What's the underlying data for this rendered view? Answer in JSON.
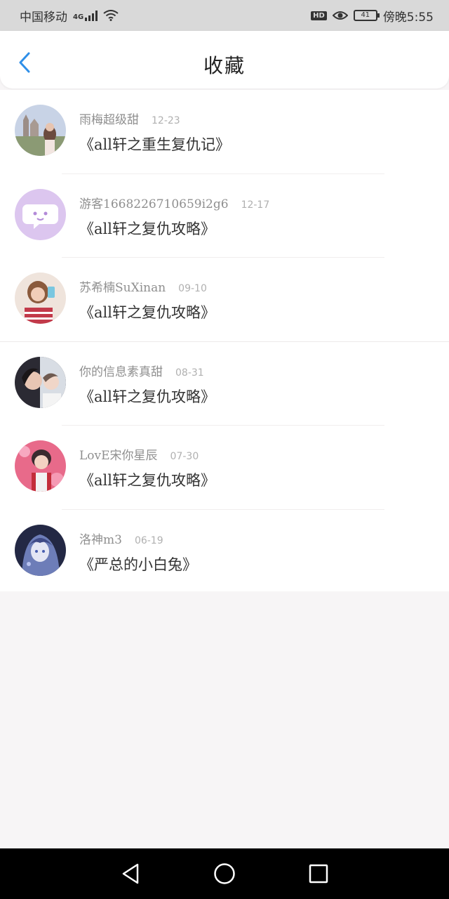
{
  "status_bar": {
    "carrier": "中国移动",
    "network": "4G",
    "time": "傍晚5:55",
    "hd": "HD",
    "battery": "41"
  },
  "header": {
    "title": "收藏",
    "back_icon": "chevron-left-icon"
  },
  "favorites": [
    {
      "username": "雨梅超级甜",
      "date": "12-23",
      "book": "《all轩之重生复仇记》"
    },
    {
      "username": "游客1668226710659i2g6",
      "date": "12-17",
      "book": "《all轩之复仇攻略》"
    },
    {
      "username": "苏希楠SuXinan",
      "date": "09-10",
      "book": "《all轩之复仇攻略》"
    },
    {
      "username": "你的信息素真甜",
      "date": "08-31",
      "book": "《all轩之复仇攻略》"
    },
    {
      "username": "LovE宋你星辰",
      "date": "07-30",
      "book": "《all轩之复仇攻略》"
    },
    {
      "username": "洛神m3",
      "date": "06-19",
      "book": "《严总的小白兔》"
    }
  ],
  "nav_bar": {
    "back_icon": "triangle-back-icon",
    "home_icon": "circle-home-icon",
    "recents_icon": "square-recents-icon"
  },
  "colors": {
    "accent": "#2f8fe8",
    "status_bar_bg": "#d9d9d9",
    "page_bg": "#f7f5f6",
    "nav_bar_bg": "#000000"
  }
}
